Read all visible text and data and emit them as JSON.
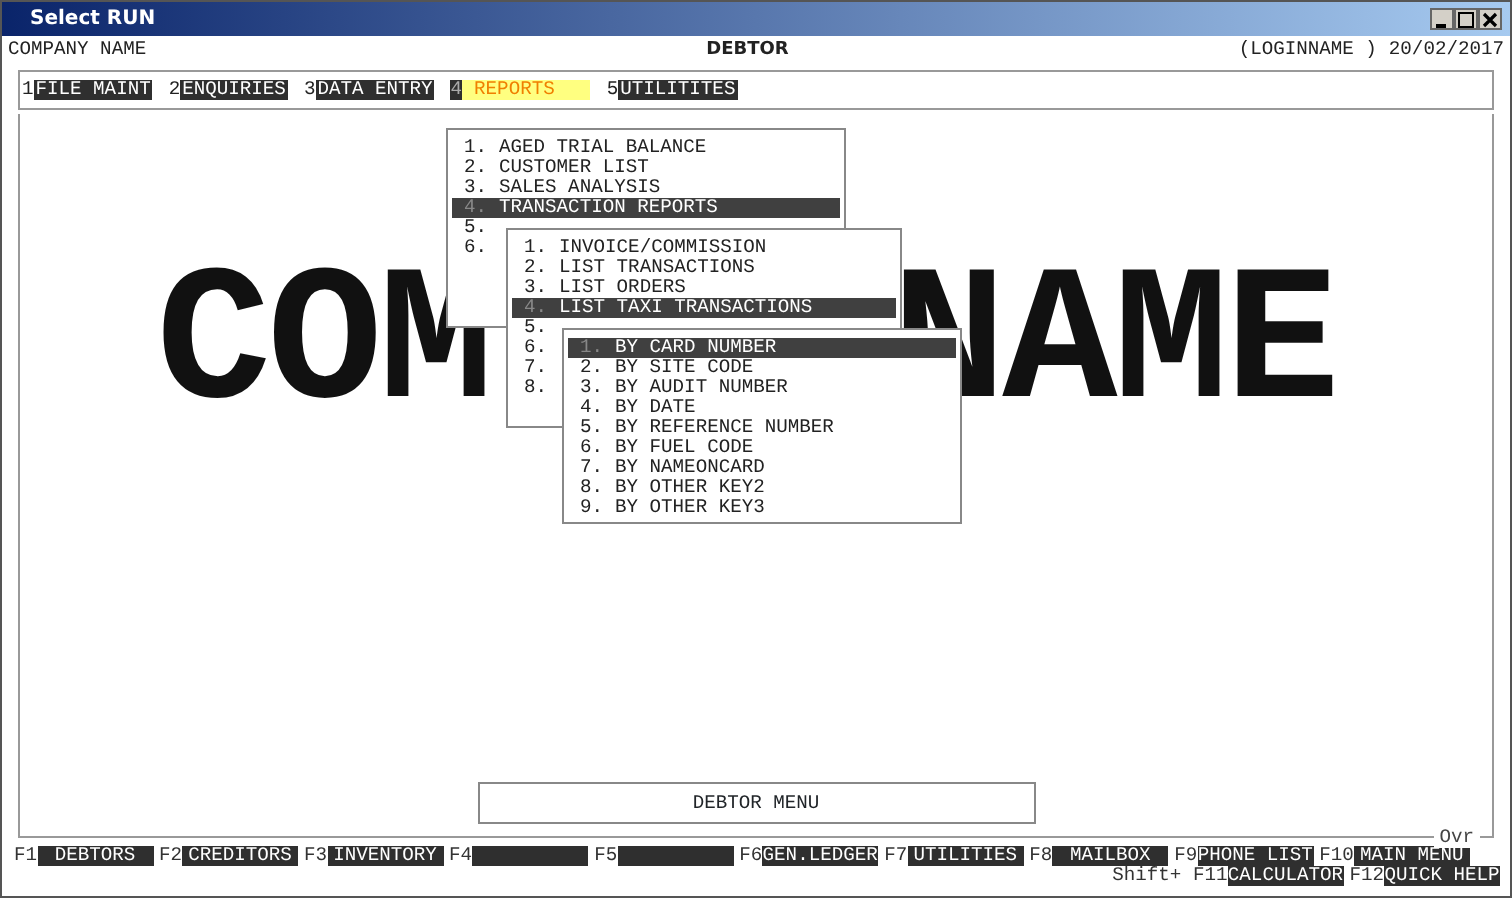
{
  "window": {
    "title": "Select RUN"
  },
  "header": {
    "company": "COMPANY NAME",
    "module": "DEBTOR",
    "user": "(LOGINNAME )",
    "date": "20/02/2017"
  },
  "menu_bar": [
    {
      "key": "1",
      "label": "FILE MAINT",
      "selected": false
    },
    {
      "key": "2",
      "label": "ENQUIRIES",
      "selected": false
    },
    {
      "key": "3",
      "label": "DATA ENTRY",
      "selected": false
    },
    {
      "key": "4",
      "label": "REPORTS",
      "selected": true
    },
    {
      "key": "5",
      "label": "UTILITITES",
      "selected": false
    }
  ],
  "banner": [
    "COM",
    "NAME"
  ],
  "menus": [
    {
      "items": [
        {
          "number": "1.",
          "label": "AGED TRIAL BALANCE",
          "selected": false
        },
        {
          "number": "2.",
          "label": "CUSTOMER LIST",
          "selected": false
        },
        {
          "number": "3.",
          "label": "SALES ANALYSIS",
          "selected": false
        },
        {
          "number": "4.",
          "label": "TRANSACTION REPORTS",
          "selected": true
        },
        {
          "number": "5.",
          "selected": false
        },
        {
          "number": "6.",
          "selected": false
        }
      ]
    },
    {
      "items": [
        {
          "number": "1.",
          "label": "INVOICE/COMMISSION",
          "selected": false
        },
        {
          "number": "2.",
          "label": "LIST TRANSACTIONS",
          "selected": false
        },
        {
          "number": "3.",
          "label": "LIST ORDERS",
          "selected": false
        },
        {
          "number": "4.",
          "label": "LIST TAXI TRANSACTIONS",
          "selected": true
        },
        {
          "number": "5.",
          "selected": false
        },
        {
          "number": "6.",
          "selected": false
        },
        {
          "number": "7.",
          "selected": false
        },
        {
          "number": "8.",
          "selected": false
        }
      ]
    },
    {
      "items": [
        {
          "number": "1.",
          "label": "BY CARD NUMBER",
          "selected": true
        },
        {
          "number": "2.",
          "label": "BY SITE CODE",
          "selected": false
        },
        {
          "number": "3.",
          "label": "BY AUDIT NUMBER",
          "selected": false
        },
        {
          "number": "4.",
          "label": "BY DATE",
          "selected": false
        },
        {
          "number": "5.",
          "label": "BY REFERENCE NUMBER",
          "selected": false
        },
        {
          "number": "6.",
          "label": "BY FUEL CODE",
          "selected": false
        },
        {
          "number": "7.",
          "label": "BY NAMEONCARD",
          "selected": false
        },
        {
          "number": "8.",
          "label": "BY OTHER KEY2",
          "selected": false
        },
        {
          "number": "9.",
          "label": "BY OTHER KEY3",
          "selected": false
        }
      ]
    }
  ],
  "menu_title": "DEBTOR MENU",
  "mode": "Ovr",
  "function_keys": [
    {
      "key": "F1",
      "label": "DEBTORS"
    },
    {
      "key": "F2",
      "label": "CREDITORS"
    },
    {
      "key": "F3",
      "label": "INVENTORY"
    },
    {
      "key": "F4"
    },
    {
      "key": "F5"
    },
    {
      "key": "F6",
      "label": "GEN.LEDGER"
    },
    {
      "key": "F7",
      "label": "UTILITIES"
    },
    {
      "key": "F8",
      "label": "MAILBOX"
    },
    {
      "key": "F9",
      "label": "PHONE LIST"
    },
    {
      "key": "F10",
      "label": "MAIN MENU"
    }
  ],
  "shift_keys": [
    {
      "prefix": "Shift+",
      "key": "F11",
      "label": "CALCULATOR"
    },
    {
      "key": "F12",
      "label": "QUICK HELP"
    }
  ]
}
